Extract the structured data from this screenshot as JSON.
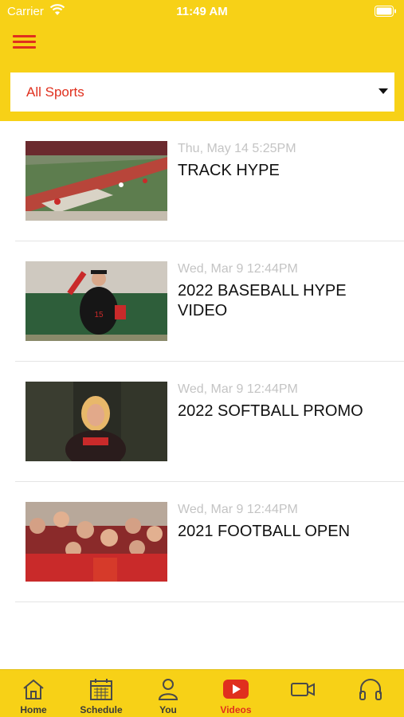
{
  "status_bar": {
    "carrier": "Carrier",
    "time": "11:49 AM"
  },
  "filter": {
    "selected": "All Sports"
  },
  "videos": [
    {
      "date": "Thu, May 14 5:25PM",
      "title": "TRACK HYPE"
    },
    {
      "date": "Wed, Mar 9 12:44PM",
      "title": "2022 BASEBALL HYPE VIDEO"
    },
    {
      "date": "Wed, Mar 9 12:44PM",
      "title": "2022 SOFTBALL PROMO"
    },
    {
      "date": "Wed, Mar 9 12:44PM",
      "title": "2021 FOOTBALL OPEN"
    }
  ],
  "tabs": [
    {
      "label": "Home",
      "icon": "home-icon"
    },
    {
      "label": "Schedule",
      "icon": "calendar-icon"
    },
    {
      "label": "You",
      "icon": "person-icon"
    },
    {
      "label": "Videos",
      "icon": "play-icon",
      "active": true
    },
    {
      "label": "",
      "icon": "video-camera-icon"
    },
    {
      "label": "",
      "icon": "headphones-icon"
    }
  ],
  "colors": {
    "brand_yellow": "#f7d117",
    "accent_red": "#e0301e"
  }
}
